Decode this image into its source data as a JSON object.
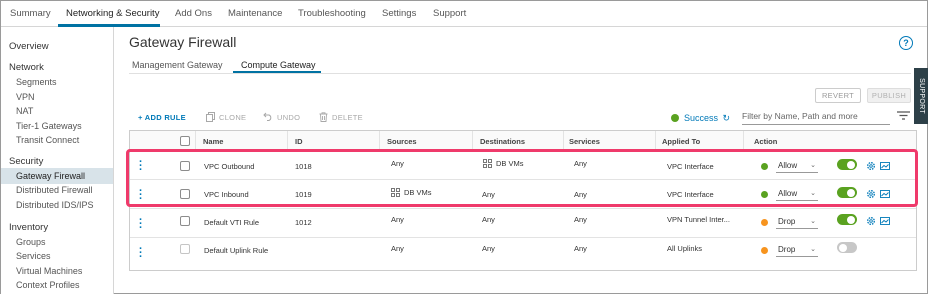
{
  "topnav": {
    "tabs": [
      "Summary",
      "Networking & Security",
      "Add Ons",
      "Maintenance",
      "Troubleshooting",
      "Settings",
      "Support"
    ]
  },
  "sidebar": {
    "overview": "Overview",
    "network_head": "Network",
    "network_items": [
      "Segments",
      "VPN",
      "NAT",
      "Tier-1 Gateways",
      "Transit Connect"
    ],
    "security_head": "Security",
    "security_items": [
      "Gateway Firewall",
      "Distributed Firewall",
      "Distributed IDS/IPS"
    ],
    "inventory_head": "Inventory",
    "inventory_items": [
      "Groups",
      "Services",
      "Virtual Machines",
      "Context Profiles"
    ]
  },
  "page": {
    "title": "Gateway Firewall",
    "help": "?",
    "subtabs": [
      "Management Gateway",
      "Compute Gateway"
    ]
  },
  "toolbar": {
    "revert": "REVERT",
    "publish": "PUBLISH",
    "add_rule": "+ ADD RULE",
    "clone": "CLONE",
    "undo": "UNDO",
    "delete": "DELETE",
    "success": "Success",
    "filter_placeholder": "Filter by Name, Path and more",
    "support": "SUPPORT"
  },
  "table": {
    "headers": [
      "Name",
      "ID",
      "Sources",
      "Destinations",
      "Services",
      "Applied To",
      "Action"
    ],
    "rows": [
      {
        "name": "VPC Outbound",
        "id": "1018",
        "sources": "Any",
        "destinations": "DB VMs",
        "services": "Any",
        "applied_to": "VPC Interface",
        "action": "Allow",
        "enabled": true
      },
      {
        "name": "VPC Inbound",
        "id": "1019",
        "sources": "DB VMs",
        "destinations": "Any",
        "services": "Any",
        "applied_to": "VPC Interface",
        "action": "Allow",
        "enabled": true
      },
      {
        "name": "Default VTI Rule",
        "id": "1012",
        "sources": "Any",
        "destinations": "Any",
        "services": "Any",
        "applied_to": "VPN Tunnel Inter...",
        "action": "Drop",
        "enabled": true
      },
      {
        "name": "Default Uplink Rule",
        "id": "",
        "sources": "Any",
        "destinations": "Any",
        "services": "Any",
        "applied_to": "All Uplinks",
        "action": "Drop",
        "enabled": false
      }
    ]
  },
  "colors": {
    "accent": "#0072a3",
    "allow": "#5aa220",
    "drop": "#f7941e",
    "toggle_on": "#5aa220",
    "toggle_off": "#c7c7c7",
    "highlight": "#ef3a6b"
  }
}
